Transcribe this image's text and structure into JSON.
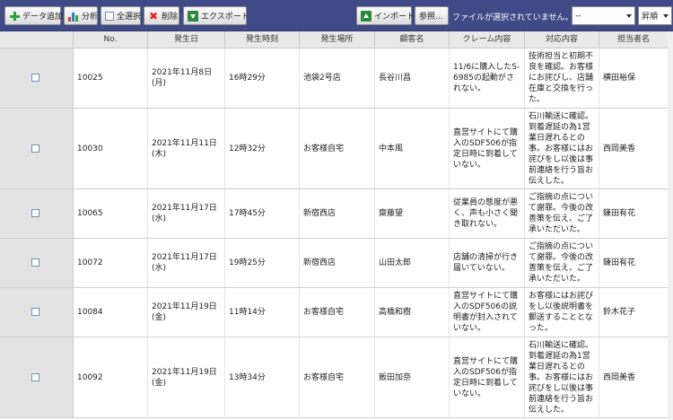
{
  "toolbar": {
    "add_data_label": "データ追加",
    "analysis_label": "分析",
    "select_all_label": "全選択",
    "delete_label": "削除",
    "export_label": "エクスポート",
    "import_label": "インポート",
    "browse_label": "参照...",
    "file_status": "ファイルが選択されていません。",
    "filter_select_value": "--",
    "sort_select_value": "昇順"
  },
  "table": {
    "headers": {
      "no": "No.",
      "date": "発生日",
      "time": "発生時刻",
      "place": "発生場所",
      "customer": "顧客名",
      "complaint": "クレーム内容",
      "response": "対応内容",
      "person": "担当者名"
    },
    "rows": [
      {
        "no": "10025",
        "date": "2021年11月8日\n(月)",
        "time": "16時29分",
        "place": "池袋2号店",
        "customer": "長谷川昌",
        "complaint": "11/6に購入したS-6985の起動がされない。",
        "response": "技術担当と初期不良を確認。お客様にお詫びし、店舗在庫と交換を行った。",
        "person": "横田裕保"
      },
      {
        "no": "10030",
        "date": "2021年11月11日\n(木)",
        "time": "12時32分",
        "place": "お客様自宅",
        "customer": "中本風",
        "complaint": "直営サイトにて購入のSDF506が指定日時に到着していない。",
        "response": "石川輸送に確認。到着遅延の為1営業日遅れるとの事。お客様にはお詫びをし以後は事前連絡を行う旨お伝えした。",
        "person": "西岡美香"
      },
      {
        "no": "10065",
        "date": "2021年11月17日\n(水)",
        "time": "17時45分",
        "place": "新宿西店",
        "customer": "齋藤望",
        "complaint": "従業員の態度が悪く、声も小さく聞き取れない。",
        "response": "ご指摘の点について謝罪。今後の改善策を伝え、ご了承いただいた。",
        "person": "鎌田有花"
      },
      {
        "no": "10072",
        "date": "2021年11月17日\n(水)",
        "time": "19時25分",
        "place": "新宿西店",
        "customer": "山田太郎",
        "complaint": "店舗の清掃が行き届いていない。",
        "response": "ご指摘の点について謝罪。今後の改善策を伝え、ご了承いただいた。",
        "person": "鎌田有花"
      },
      {
        "no": "10084",
        "date": "2021年11月19日\n(金)",
        "time": "11時14分",
        "place": "お客様自宅",
        "customer": "高橋和樹",
        "complaint": "直営サイトにて購入のSDF506の説明書が封入されていない。",
        "response": "お客様にはお詫びをし以後説明書を郵送することとなった。",
        "person": "鈴木花子"
      },
      {
        "no": "10092",
        "date": "2021年11月19日\n(金)",
        "time": "13時34分",
        "place": "お客様自宅",
        "customer": "飯田加奈",
        "complaint": "直営サイトにて購入のSDF506が指定日時に到着していない。",
        "response": "石川輸送に確認。到着遅延の為1営業日遅れるとの事。お客様にはお詫びをし以後は事前連絡を行う旨お伝えした。",
        "person": "西岡美香"
      }
    ]
  },
  "colors": {
    "toolbar_bg": "#3f4a86",
    "header_bg": "#e9e9e9",
    "select_column_bg": "#e3e3e3",
    "checkbox_border": "#6d8fbf"
  }
}
